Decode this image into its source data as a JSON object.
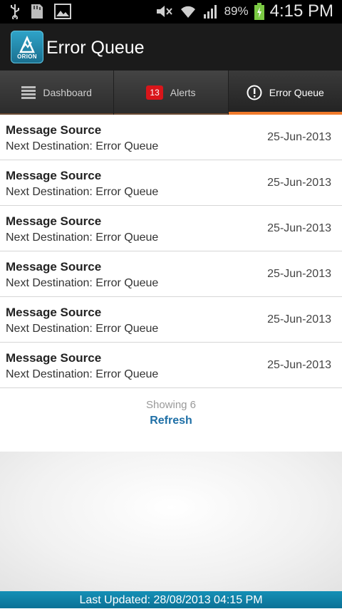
{
  "status_bar": {
    "icons": [
      "usb-icon",
      "sd-card-icon",
      "image-icon",
      "mute-icon",
      "wifi-icon",
      "signal-icon",
      "battery-icon"
    ],
    "battery_percent": "89%",
    "time": "4:15 PM"
  },
  "app": {
    "logo_text": "ORION",
    "title": "Error Queue"
  },
  "tabs": [
    {
      "label": "Dashboard",
      "icon": "list-icon"
    },
    {
      "label": "Alerts",
      "badge": "13"
    },
    {
      "label": "Error Queue",
      "icon": "exclamation-circle-icon"
    }
  ],
  "items": [
    {
      "title": "Message Source",
      "subtitle": "Next Destination: Error Queue",
      "date": "25-Jun-2013"
    },
    {
      "title": "Message Source",
      "subtitle": "Next Destination: Error Queue",
      "date": "25-Jun-2013"
    },
    {
      "title": "Message Source",
      "subtitle": "Next Destination: Error Queue",
      "date": "25-Jun-2013"
    },
    {
      "title": "Message Source",
      "subtitle": "Next Destination: Error Queue",
      "date": "25-Jun-2013"
    },
    {
      "title": "Message Source",
      "subtitle": "Next Destination: Error Queue",
      "date": "25-Jun-2013"
    },
    {
      "title": "Message Source",
      "subtitle": "Next Destination: Error Queue",
      "date": "25-Jun-2013"
    }
  ],
  "list_footer": {
    "showing": "Showing 6",
    "refresh": "Refresh"
  },
  "bottom_bar": {
    "last_updated": "Last Updated: 28/08/2013 04:15 PM"
  },
  "colors": {
    "tab_accent": "#f07a2b",
    "badge": "#d9151a",
    "refresh_link": "#1e6fa6",
    "bottom_bar": "#1590b6"
  }
}
